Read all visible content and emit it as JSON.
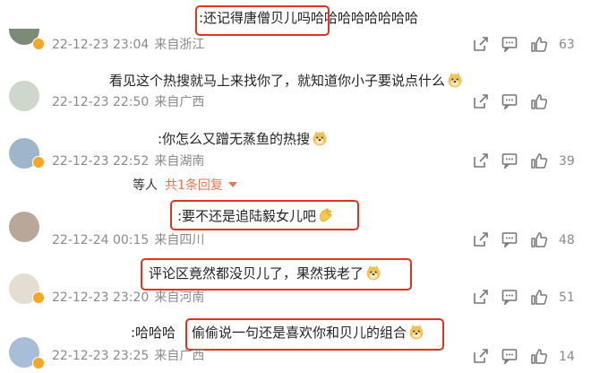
{
  "comments": [
    {
      "text": ":还记得唐僧贝儿吗哈哈哈哈哈哈哈哈",
      "date": "22-12-23 23:04",
      "location": "来自浙江",
      "likes": "63"
    },
    {
      "text": "看见这个热搜就马上来找你了，就知道你小子要说点什么",
      "date": "22-12-23 22:50",
      "location": "来自广西",
      "likes": ""
    },
    {
      "text": ":你怎么又蹭无蒸鱼的热搜",
      "date": "22-12-23 22:52",
      "location": "来自湖南",
      "likes": "39"
    },
    {
      "text": ":要不还是追陆毅女儿吧",
      "date": "22-12-24 00:15",
      "location": "来自四川",
      "likes": "48"
    },
    {
      "text": "评论区竟然都没贝儿了，果然我老了",
      "date": "22-12-23 23:20",
      "location": "来自河南",
      "likes": "51"
    },
    {
      "text_prefix": ":哈哈哈",
      "text": "偷偷说一句还是喜欢你和贝儿的组合",
      "date": "22-12-23 23:25",
      "location": "来自广西",
      "likes": "14"
    }
  ],
  "reply_summary": {
    "by": "等人",
    "link": "共1条回复"
  },
  "colors": {
    "highlight": "#e0341f",
    "meta": "#8a8a8a",
    "link": "#eb7350",
    "badge": "#f5a623"
  },
  "icons": [
    "share-icon",
    "comment-icon",
    "like-icon",
    "doge-emoji-icon"
  ]
}
